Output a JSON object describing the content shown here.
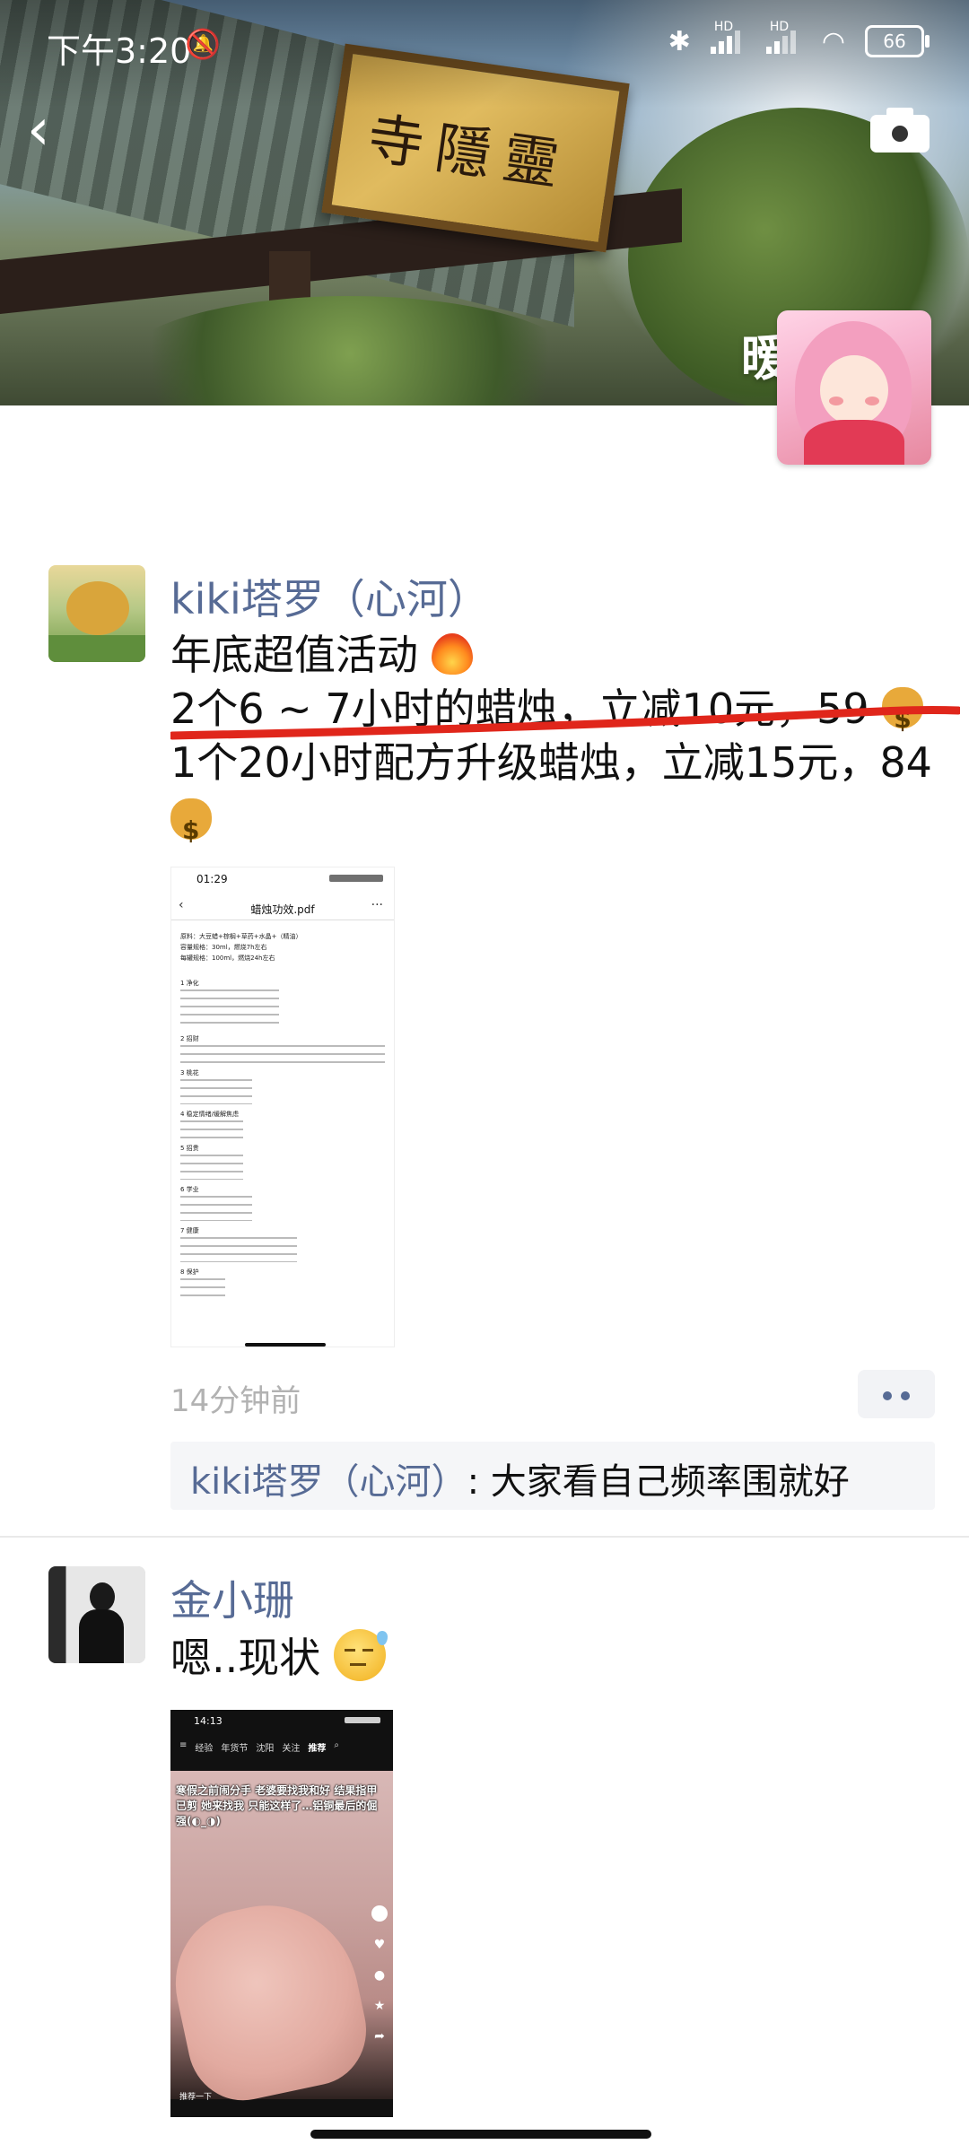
{
  "status_bar": {
    "time": "下午3:20",
    "battery": "66",
    "hd1": "HD",
    "hd2": "HD"
  },
  "header": {
    "cover_plaque_text": "寺隱靈",
    "profile_name": "暧"
  },
  "posts": [
    {
      "author": "kiki塔罗（心河）",
      "lines": [
        "年底超值活动",
        "2个6 ~ 7小时的蜡烛，立减10元，59",
        "1个20小时配方升级蜡烛，立减15元，84"
      ],
      "emojis": [
        "fire-icon",
        "money-bag-icon",
        "money-bag-icon"
      ],
      "attachment": {
        "status_time": "01:29",
        "title": "蜡烛功效.pdf",
        "lines": [
          "原料：大豆蜡+棕榈+草药+水晶+（精油）",
          "容量规格：30ml，燃烧7h左右",
          "每罐规格：100ml，燃烧24h左右",
          "1 净化",
          "2 招财",
          "3 桃花",
          "4 稳定情绪/缓解焦虑",
          "5 招贵",
          "6 学业",
          "7 健康",
          "8 保护"
        ]
      },
      "time": "14分钟前",
      "comment": {
        "author": "kiki塔罗（心河）",
        "separator": ":",
        "text": " 大家看自己频率围就好"
      }
    },
    {
      "author": "金小珊",
      "lines": [
        "嗯..现状"
      ],
      "emojis": [
        "sleepy-face-icon"
      ],
      "attachment": {
        "status_time": "14:13",
        "nav": [
          "经验",
          "年货节",
          "沈阳",
          "关注",
          "推荐"
        ],
        "caption": "寒假之前闹分手 老婆要找我和好 结果指甲已剪 她来找我 只能这样了…铝铜最后的倔强(◐_◑)",
        "bottom_label": "推荐一下"
      }
    }
  ],
  "colors": {
    "link_blue": "#576b95",
    "timestamp_gray": "#b2b2b2",
    "annotation_red": "#e0261b"
  }
}
